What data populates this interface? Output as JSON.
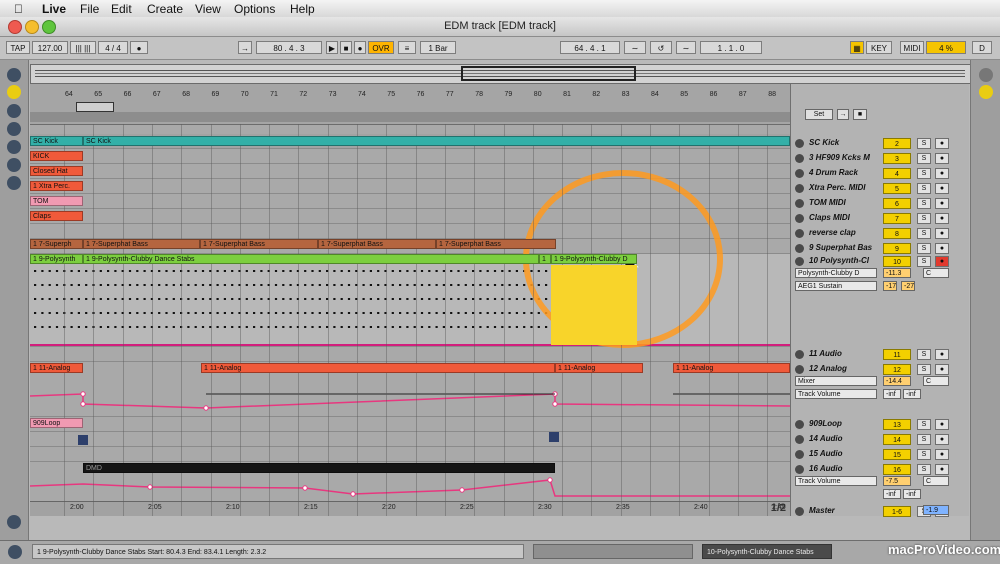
{
  "menubar": {
    "app": "Live",
    "items": [
      "File",
      "Edit",
      "Create",
      "View",
      "Options",
      "Help"
    ]
  },
  "window": {
    "title": "EDM track  [EDM track]"
  },
  "transport": {
    "tap": "TAP",
    "tempo": "127.00",
    "time_signature": "4 / 4",
    "position": "80 .    4 .    3",
    "overdub": "OVR",
    "quantize": "1 Bar",
    "loop_start": "64 .    4 .    1",
    "loop_length": "1 .    1 .    0",
    "key": "KEY",
    "midi": "MIDI",
    "cpu": "4 %",
    "d_indicator": "D"
  },
  "ruler": {
    "bars": [
      "64",
      "65",
      "66",
      "67",
      "68",
      "69",
      "70",
      "71",
      "72",
      "73",
      "74",
      "75",
      "76",
      "77",
      "78",
      "79",
      "80",
      "81",
      "82",
      "83",
      "84",
      "85",
      "86",
      "87",
      "88"
    ]
  },
  "time_axis": [
    "2:00",
    "2:05",
    "2:10",
    "2:15",
    "2:20",
    "2:25",
    "2:30",
    "2:35",
    "2:40",
    "2:45"
  ],
  "page_indicator": "1/2",
  "set_button": "Set",
  "clips": {
    "sc_kick": [
      "SC Kick",
      "SC Kick"
    ],
    "kick": "KICK",
    "closed_hat": "Closed Hat",
    "xtra_perc": "1 Xtra Perc.",
    "tom": "TOM",
    "claps": "Claps",
    "superphat": [
      "1 7-Superph",
      "1 7-Superphat Bass",
      "1 7-Superphat Bass",
      "1 7-Superphat Bass",
      "1 7-Superphat Bass"
    ],
    "polysynth": [
      "1 9-Polysynth",
      "1 9-Polysynth-Clubby Dance Stabs",
      "1",
      "1 9-Polysynth-Clubby D"
    ],
    "analog": [
      "1 11-Analog",
      "1 11-Analog",
      "1 11-Analog",
      "1 11-Analog"
    ],
    "loop909": "909Loop",
    "dmd": "DMD"
  },
  "mixer": {
    "tracks": [
      {
        "name": "SC Kick",
        "num": "2"
      },
      {
        "name": "3 HF909 Kcks M",
        "num": "3"
      },
      {
        "name": "4 Drum Rack",
        "num": "4"
      },
      {
        "name": "Xtra Perc. MIDI",
        "num": "5"
      },
      {
        "name": "TOM MIDI",
        "num": "6"
      },
      {
        "name": "Claps MIDI",
        "num": "7"
      },
      {
        "name": "reverse clap",
        "num": "8"
      },
      {
        "name": "9 Superphat Bas",
        "num": "9"
      },
      {
        "name": "10 Polysynth-Cl",
        "num": "10"
      },
      {
        "name": "11 Audio",
        "num": "11"
      },
      {
        "name": "12 Analog",
        "num": "12"
      },
      {
        "name": "909Loop",
        "num": "13"
      },
      {
        "name": "14 Audio",
        "num": "14"
      },
      {
        "name": "15 Audio",
        "num": "15"
      },
      {
        "name": "16 Audio",
        "num": "16"
      },
      {
        "name": "Master",
        "num": "1-6"
      }
    ],
    "solo": "S",
    "poly_device": "Polysynth-Clubby D",
    "poly_param": "AEG1 Sustain",
    "poly_vol": "-11.3",
    "poly_pan": "C",
    "poly_v1": "-17",
    "poly_v2": "-27",
    "analog_device": "Mixer",
    "analog_param": "Track Volume",
    "analog_vol": "-14.4",
    "analog_pan": "C",
    "analog_inf1": "-inf",
    "analog_inf2": "-inf",
    "audio16_param": "Track Volume",
    "audio16_vol": "-7.5",
    "audio16_pan": "C",
    "audio16_inf1": "-inf",
    "audio16_inf2": "-inf",
    "master_vol2": "-1.9"
  },
  "status": {
    "text": "1 9-Polysynth-Clubby Dance Stabs  Start: 80.4.3  End: 83.4.1  Length: 2.3.2",
    "detail": "10-Polysynth-Clubby Dance Stabs"
  },
  "watermark": "macProVideo.com",
  "colors": {
    "kick_teal": "#33b0a8",
    "red_clip": "#f05a3a",
    "pink_clip": "#f19ab2",
    "brown_clip": "#b5653f",
    "green_clip": "#7ccf3f",
    "yellow_sel": "#f8d42a",
    "track_num": "#f3d000",
    "highlight_circle": "#ff9a1e"
  }
}
